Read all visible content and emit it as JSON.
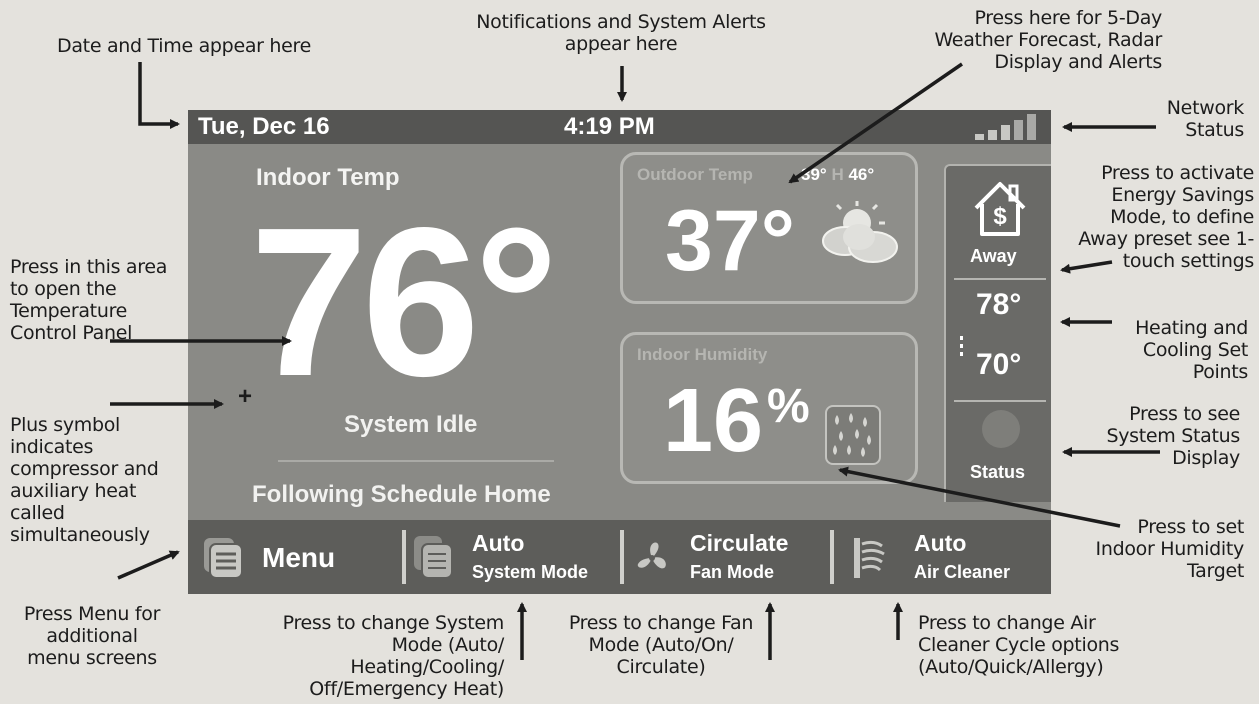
{
  "thermostat": {
    "date": "Tue, Dec 16",
    "time": "4:19 PM",
    "indoor_label": "Indoor Temp",
    "indoor_temp": "76°",
    "plus_symbol": "+",
    "system_status": "System Idle",
    "schedule": "Following Schedule Home",
    "outdoor": {
      "label": "Outdoor Temp",
      "low": "39°",
      "high_prefix": "H",
      "high": "46°",
      "temp": "37°",
      "icon": "partly-cloudy-icon"
    },
    "humidity": {
      "label": "Indoor Humidity",
      "value": "16",
      "unit": "%",
      "icon": "humidity-drops-icon"
    },
    "away": {
      "label": "Away",
      "icon": "house-dollar-icon"
    },
    "setpoints": {
      "heat": "78°",
      "cool": "70°"
    },
    "status": {
      "label": "Status"
    },
    "network": {
      "icon": "signal-bars-icon",
      "bars": 5,
      "active_bars": 3
    },
    "bottom": {
      "menu": "Menu",
      "system_mode_value": "Auto",
      "system_mode_label": "System Mode",
      "fan_value": "Circulate",
      "fan_label": "Fan Mode",
      "air_value": "Auto",
      "air_label": "Air Cleaner"
    },
    "colors": {
      "screen": "#8a8a86",
      "bar": "#555553",
      "text": "#ffffff"
    }
  },
  "annotations": {
    "date_time": "Date and Time appear here",
    "notifications": "Notifications and System Alerts appear here",
    "weather": "Press here for 5-Day Weather Forecast, Radar Display and Alerts",
    "network": "Network Status",
    "energy": "Press to activate Energy Savings Mode, to define Away preset see 1-touch settings",
    "temp_panel": "Press in this area to open the Temperature Control Panel",
    "setpoints": "Heating and Cooling Set Points",
    "plus": "Plus symbol indicates compressor and auxiliary heat called simultaneously",
    "status": "Press to see System Status Display",
    "humidity": "Press to set Indoor Humidity Target",
    "menu": "Press Menu for additional menu screens",
    "system_mode": "Press to change System Mode (Auto/ Heating/Cooling/ Off/Emergency Heat)",
    "fan_mode": "Press to change Fan Mode (Auto/On/ Circulate)",
    "air_cleaner": "Press to change Air Cleaner Cycle options (Auto/Quick/Allergy)"
  }
}
